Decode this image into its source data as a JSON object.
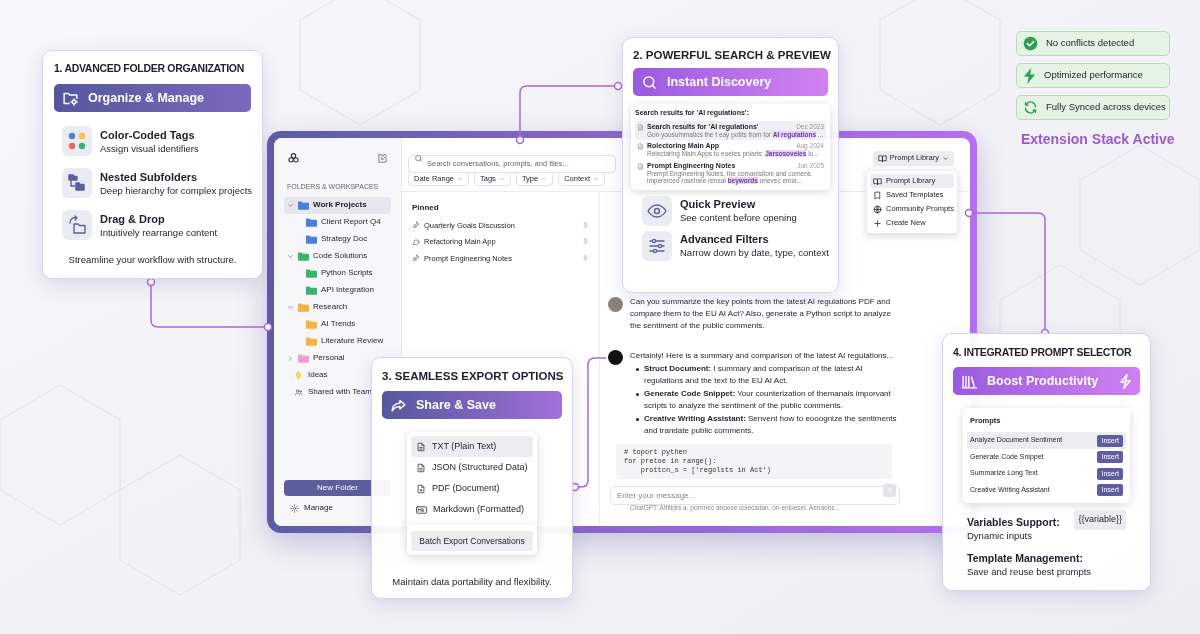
{
  "folder_organization": {
    "title": "1. ADVANCED FOLDER ORGANIZATION",
    "banner": "Organize & Manage",
    "features": [
      {
        "kind": "tags",
        "title": "Color-Coded Tags",
        "description": "Assign visual identifiers"
      },
      {
        "kind": "subfolders",
        "title": "Nested Subfolders",
        "description": "Deep hierarchy for complex projects"
      },
      {
        "kind": "dragdrop",
        "title": "Drag & Drop",
        "description": "Intuitively rearrange content"
      }
    ],
    "footer": "Streamline your workflow with structure."
  },
  "search_preview": {
    "title": "2. POWERFUL SEARCH & PREVIEW",
    "banner": "Instant Discovery",
    "results": {
      "heading": "Search results for 'AI regulations':",
      "items": [
        {
          "title": "Search results for 'AI regulations'",
          "date": "Dec 2023",
          "snippet": "Gon yousummatics the t eay potits from for",
          "highlight": "AI regulations",
          "after": "...",
          "selected": true
        },
        {
          "title": "Rolectoring Main App",
          "date": "Aug 2024",
          "snippet": "Relectaring Main Apps to eoetes pniaris:",
          "highlight": "Jarsosoveies",
          "after": "lo...",
          "selected": false
        },
        {
          "title": "Prompt Engineering Notes",
          "date": "Jun 2025",
          "snippet": "Prempt Engineering Notes, the comanistioni and comens impererced roselnee rensal",
          "highlight": "beywords",
          "after": "onevec emia...",
          "selected": false
        }
      ]
    },
    "features": [
      {
        "kind": "preview",
        "title": "Quick Preview",
        "description": "See content before opening"
      },
      {
        "kind": "filters",
        "title": "Advanced Filters",
        "description": "Narrow down by date, type, context"
      }
    ]
  },
  "status": {
    "items": [
      {
        "kind": "check",
        "label": "No conflicts detected"
      },
      {
        "kind": "bolt",
        "label": "Optimized performance"
      },
      {
        "kind": "sync",
        "label": "Fully Synced across devices"
      }
    ],
    "caption": "Extension Stack Active"
  },
  "app": {
    "sidebar": {
      "section_title": "FOLDERS & WORKSPACES",
      "folders": [
        {
          "name": "Work Projects",
          "color": "#4a7fe0",
          "expanded": true,
          "selected": true,
          "children": [
            {
              "name": "Client Report Q4",
              "color": "#4a7fe0"
            },
            {
              "name": "Strategy Doc",
              "color": "#4a7fe0"
            }
          ]
        },
        {
          "name": "Code Solutions",
          "color": "#3bb273",
          "expanded": true,
          "selected": false,
          "children": [
            {
              "name": "Python Scripts",
              "color": "#3bb273"
            },
            {
              "name": "API Integration",
              "color": "#3bb273"
            }
          ]
        },
        {
          "name": "Research",
          "color": "#f5b342",
          "expanded": true,
          "selected": false,
          "children": [
            {
              "name": "AI Trends",
              "color": "#f5b342"
            },
            {
              "name": "Literature Review",
              "color": "#f5b342"
            }
          ]
        },
        {
          "name": "Personal",
          "color": "#f29ccf",
          "expanded": false,
          "selected": false
        }
      ],
      "extras": [
        {
          "kind": "idea",
          "label": "Ideas"
        },
        {
          "kind": "team",
          "label": "Shared with Team"
        }
      ],
      "new_folder_button": "New Folder",
      "manage": "Manage"
    },
    "search": {
      "placeholder": "Search conversations, prompts, and files..."
    },
    "filters": [
      "Date Range",
      "Tags",
      "Type",
      "Context"
    ],
    "pinned": {
      "title": "Pinned",
      "items": [
        {
          "kind": "pin",
          "label": "Quarterly Goals Discussion"
        },
        {
          "kind": "chat",
          "label": "Refactoring Main App"
        },
        {
          "kind": "pin",
          "label": "Prompt Engineering Notes"
        }
      ]
    },
    "prompt_library": {
      "button": "Prompt Library",
      "menu": [
        {
          "kind": "library",
          "label": "Prompt Library",
          "selected": true
        },
        {
          "kind": "template",
          "label": "Saved Templates",
          "selected": false
        },
        {
          "kind": "community",
          "label": "Community Prompts",
          "selected": false
        },
        {
          "kind": "create",
          "label": "Create New",
          "selected": false
        }
      ]
    },
    "chat": {
      "user_message": "Can you summarize the key points from the latest AI regulations PDF and compare them to the EU AI Act? Also, generate a Python script to analyze the sentiment of the public comments.",
      "assistant_intro": "Certainly! Here is a summary and comparison of the latest AI regulations...",
      "bullets": [
        "**Struct Document:** I summary and comparison of the latest AI regulations and the text to the EU AI Act.",
        "**Generate Code Snippet:** Your counterization of themanais imporvant scripts to analyze the sentiment of the public comments.",
        "**Creative Writing Assistant:** Senvent how to eooognize the sentiments and trandate public comments."
      ],
      "code": [
        "# toport pythen",
        "for pretoe in range():",
        "    prottcn_s = ['regolsts in Act')"
      ],
      "input_placeholder": "Enter your message...",
      "footnote": "ChatGPT: Attitidrs a. porrmec anoose colecadan, on enloesel. Aenaohs..."
    }
  },
  "export_options": {
    "title": "3. SEAMLESS EXPORT OPTIONS",
    "banner": "Share & Save",
    "options": [
      {
        "kind": "text",
        "label": "TXT (Plain Text)",
        "selected": true
      },
      {
        "kind": "text",
        "label": "JSON (Structured Data)",
        "selected": false
      },
      {
        "kind": "pdf",
        "label": "PDF (Document)",
        "selected": false
      },
      {
        "kind": "markdown",
        "label": "Markdown (Formatted)",
        "selected": false
      }
    ],
    "batch_button": "Batch Export Conversations",
    "footer": "Maintain data portability and flexibility."
  },
  "prompt_selector": {
    "title": "4. INTEGRATED PROMPT SELECTOR",
    "banner": "Boost Productivity",
    "panel_title": "Prompts",
    "prompts": [
      {
        "label": "Analyze Document Sentiment",
        "action": "Insert",
        "selected": true
      },
      {
        "label": "Generate Code Snippet",
        "action": "Insert",
        "selected": false
      },
      {
        "label": "Summarize Long Text",
        "action": "Insert",
        "selected": false
      },
      {
        "label": "Creative Writing Assistant",
        "action": "Insert",
        "selected": false
      }
    ],
    "features": [
      {
        "title": "Variables Support:",
        "description": "Dynamic inputs",
        "tag": "{{variable}}"
      },
      {
        "title": "Template Management:",
        "description": "Save and reuse best prompts"
      }
    ]
  }
}
